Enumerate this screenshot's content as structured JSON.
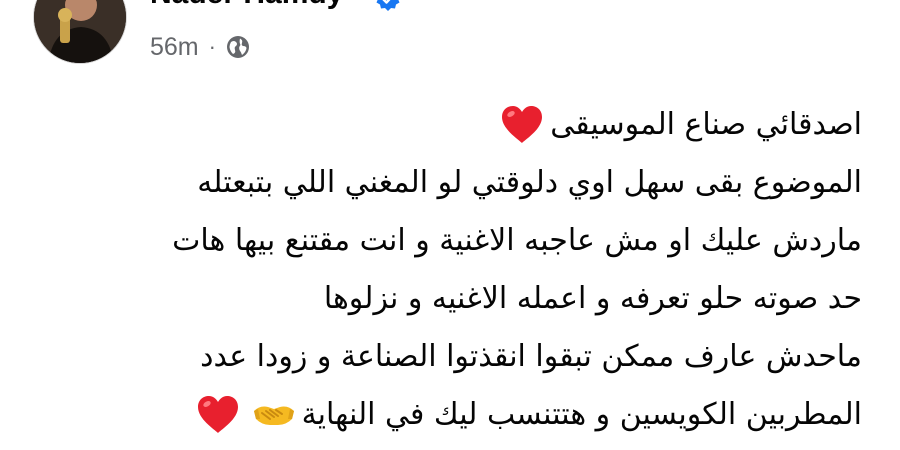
{
  "post": {
    "author": "Nader Hamdy",
    "verified": true,
    "timestamp": "56m",
    "separator": "·",
    "audience_icon": "globe-icon",
    "lines": [
      "اصدقائي صناع الموسيقى",
      "الموضوع بقى سهل اوي دلوقتي لو المغني اللي بتبعتله",
      "ماردش عليك او مش عاجبه الاغنية و انت مقتنع بيها هات",
      "حد صوته حلو تعرفه و اعمله الاغنيه و نزلوها",
      "ماحدش عارف ممكن تبقوا انقذتوا الصناعة و زودا عدد",
      "المطربين الكويسين و هتتنسب ليك في النهاية"
    ],
    "emojis": {
      "line1_end": "red-heart-icon",
      "line6_end_1": "handshake-icon",
      "line6_end_2": "red-heart-icon"
    }
  },
  "colors": {
    "name_text": "#050505",
    "meta_text": "#65676b",
    "verified_blue": "#1877f2",
    "heart_red": "#e8202e"
  }
}
